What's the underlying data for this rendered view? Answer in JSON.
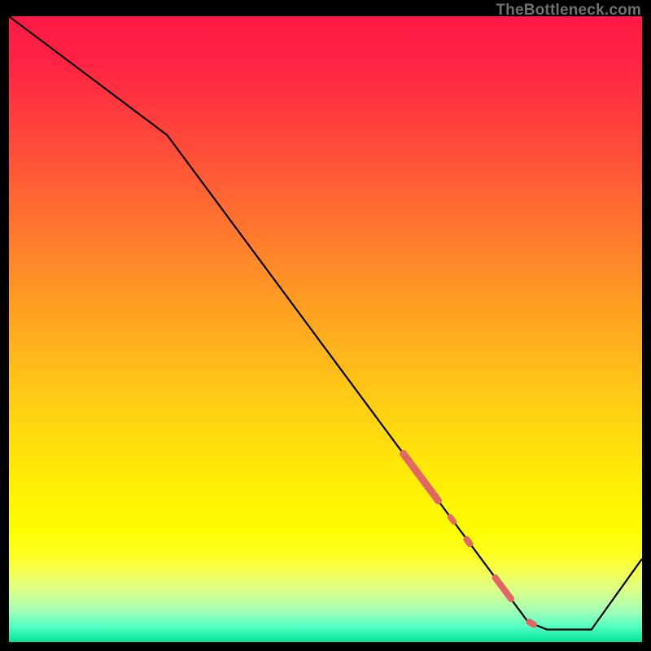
{
  "attribution": "TheBottleneck.com",
  "chart_data": {
    "type": "line",
    "xlabel": "",
    "ylabel": "",
    "xlim": [
      0,
      100
    ],
    "ylim": [
      0,
      100
    ],
    "gradient_stops": [
      {
        "offset": 0.0,
        "color": "#ff1947"
      },
      {
        "offset": 0.07,
        "color": "#ff2244"
      },
      {
        "offset": 0.22,
        "color": "#ff4f39"
      },
      {
        "offset": 0.35,
        "color": "#ff7a2e"
      },
      {
        "offset": 0.48,
        "color": "#ffa421"
      },
      {
        "offset": 0.6,
        "color": "#ffc816"
      },
      {
        "offset": 0.7,
        "color": "#ffe30b"
      },
      {
        "offset": 0.77,
        "color": "#fff305"
      },
      {
        "offset": 0.82,
        "color": "#fffc02"
      },
      {
        "offset": 0.86,
        "color": "#fdff21"
      },
      {
        "offset": 0.89,
        "color": "#f3ff57"
      },
      {
        "offset": 0.92,
        "color": "#d7ff8f"
      },
      {
        "offset": 0.95,
        "color": "#a3ffb5"
      },
      {
        "offset": 0.975,
        "color": "#55ffc3"
      },
      {
        "offset": 1.0,
        "color": "#00e499"
      }
    ],
    "series": [
      {
        "name": "bottleneck-curve",
        "points": [
          {
            "x": 0.0,
            "y": 100.0
          },
          {
            "x": 25.0,
            "y": 81.0
          },
          {
            "x": 82.0,
            "y": 3.2
          },
          {
            "x": 85.0,
            "y": 2.0
          },
          {
            "x": 92.0,
            "y": 2.0
          },
          {
            "x": 100.0,
            "y": 13.3
          }
        ]
      }
    ],
    "markers": {
      "name": "highlighted-points",
      "color": "#e06763",
      "segments": [
        {
          "x0": 62.3,
          "y0": 30.1,
          "x1": 67.8,
          "y1": 22.6,
          "width": 9
        },
        {
          "x0": 69.7,
          "y0": 20.0,
          "x1": 70.3,
          "y1": 19.2,
          "width": 7
        },
        {
          "x0": 72.3,
          "y0": 16.4,
          "x1": 72.8,
          "y1": 15.7,
          "width": 8
        },
        {
          "x0": 76.8,
          "y0": 10.3,
          "x1": 79.3,
          "y1": 6.9,
          "width": 8
        },
        {
          "x0": 82.2,
          "y0": 3.2,
          "x1": 82.9,
          "y1": 2.8,
          "width": 8
        }
      ]
    }
  }
}
